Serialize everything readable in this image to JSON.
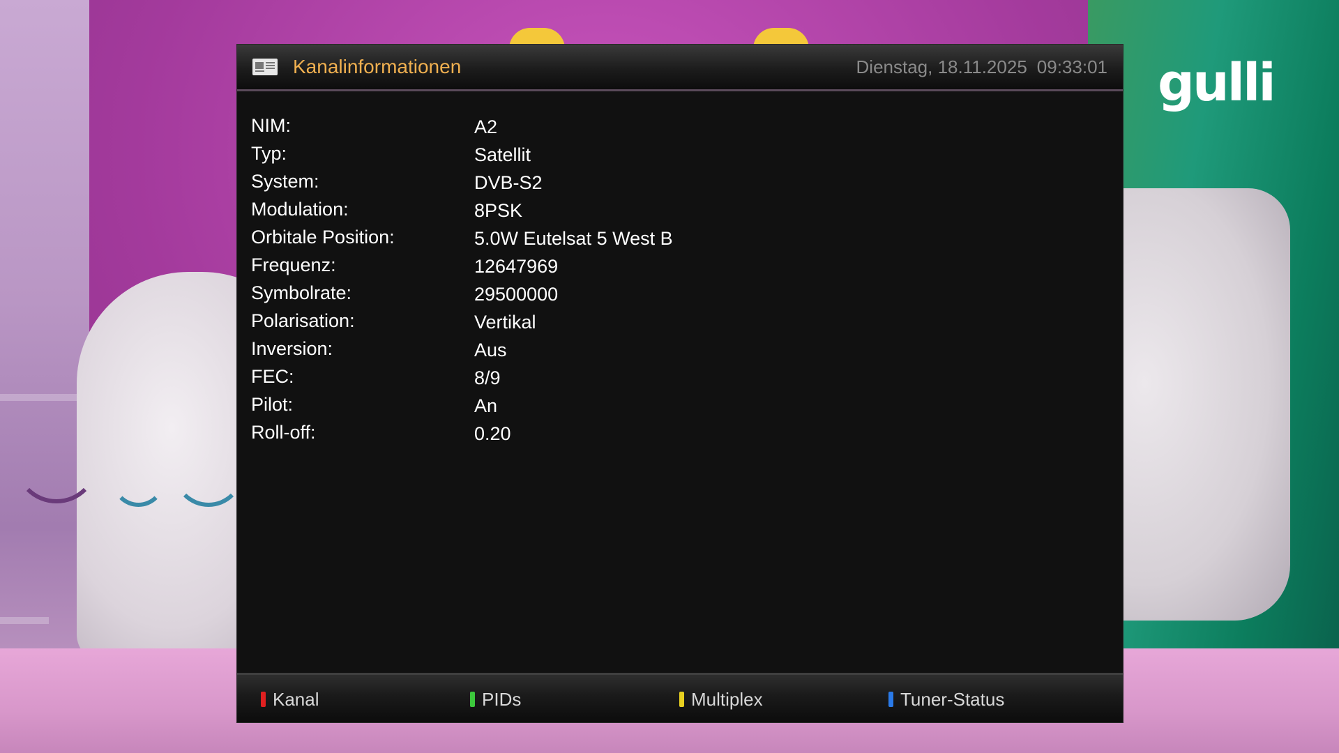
{
  "header": {
    "title": "Kanalinformationen",
    "date": "Dienstag, 18.11.2025",
    "time": "09:33:01",
    "icon": "newspaper-icon"
  },
  "channel_logo": "gulli",
  "info": {
    "rows": [
      {
        "label": "NIM:",
        "value": "A2"
      },
      {
        "label": "Typ:",
        "value": "Satellit"
      },
      {
        "label": "System:",
        "value": "DVB-S2"
      },
      {
        "label": "Modulation:",
        "value": "8PSK"
      },
      {
        "label": "Orbitale Position:",
        "value": "5.0W Eutelsat 5 West B"
      },
      {
        "label": "Frequenz:",
        "value": "12647969"
      },
      {
        "label": "Symbolrate:",
        "value": "29500000"
      },
      {
        "label": "Polarisation:",
        "value": "Vertikal"
      },
      {
        "label": "Inversion:",
        "value": "Aus"
      },
      {
        "label": "FEC:",
        "value": "8/9"
      },
      {
        "label": "Pilot:",
        "value": "An"
      },
      {
        "label": "Roll-off:",
        "value": "0.20"
      }
    ]
  },
  "footer": {
    "buttons": [
      {
        "label": "Kanal",
        "color": "#e02020",
        "key": "red-key-icon"
      },
      {
        "label": "PIDs",
        "color": "#3cc83c",
        "key": "green-key-icon"
      },
      {
        "label": "Multiplex",
        "color": "#e8d020",
        "key": "yellow-key-icon"
      },
      {
        "label": "Tuner-Status",
        "color": "#2a7ae8",
        "key": "blue-key-icon"
      }
    ]
  },
  "colors": {
    "title": "#f0b050",
    "clock": "#8a8a8a",
    "panel_bg": "#111111",
    "text": "#ffffff"
  }
}
